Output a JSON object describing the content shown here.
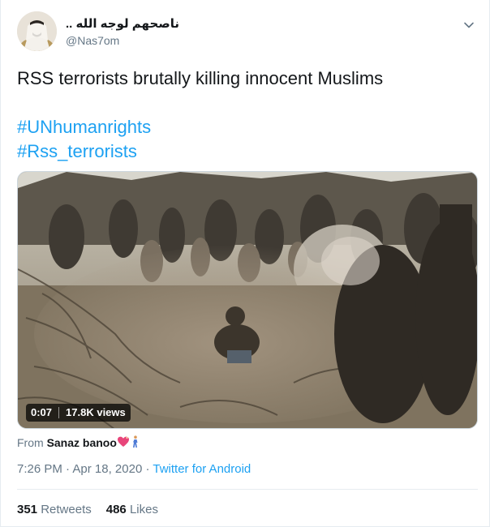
{
  "author": {
    "display_name": "ناصحهم لوجه الله ..",
    "handle": "@Nas7om"
  },
  "tweet": {
    "text_line": "RSS terrorists brutally killing innocent Muslims",
    "hashtags": [
      "#UNhumanrights",
      "#Rss_terrorists"
    ]
  },
  "video": {
    "duration": "0:07",
    "views": "17.8K views"
  },
  "attribution": {
    "from_label": "From",
    "from_name": "Sanaz banoo"
  },
  "meta": {
    "time": "7:26 PM",
    "separator": "·",
    "date": "Apr 18, 2020",
    "source": "Twitter for Android"
  },
  "stats": {
    "retweets_count": "351",
    "retweets_label": "Retweets",
    "likes_count": "486",
    "likes_label": "Likes"
  },
  "colors": {
    "link": "#1da1f2",
    "secondary_text": "#657786",
    "primary_text": "#14171a",
    "divider": "#e6ecf0"
  }
}
